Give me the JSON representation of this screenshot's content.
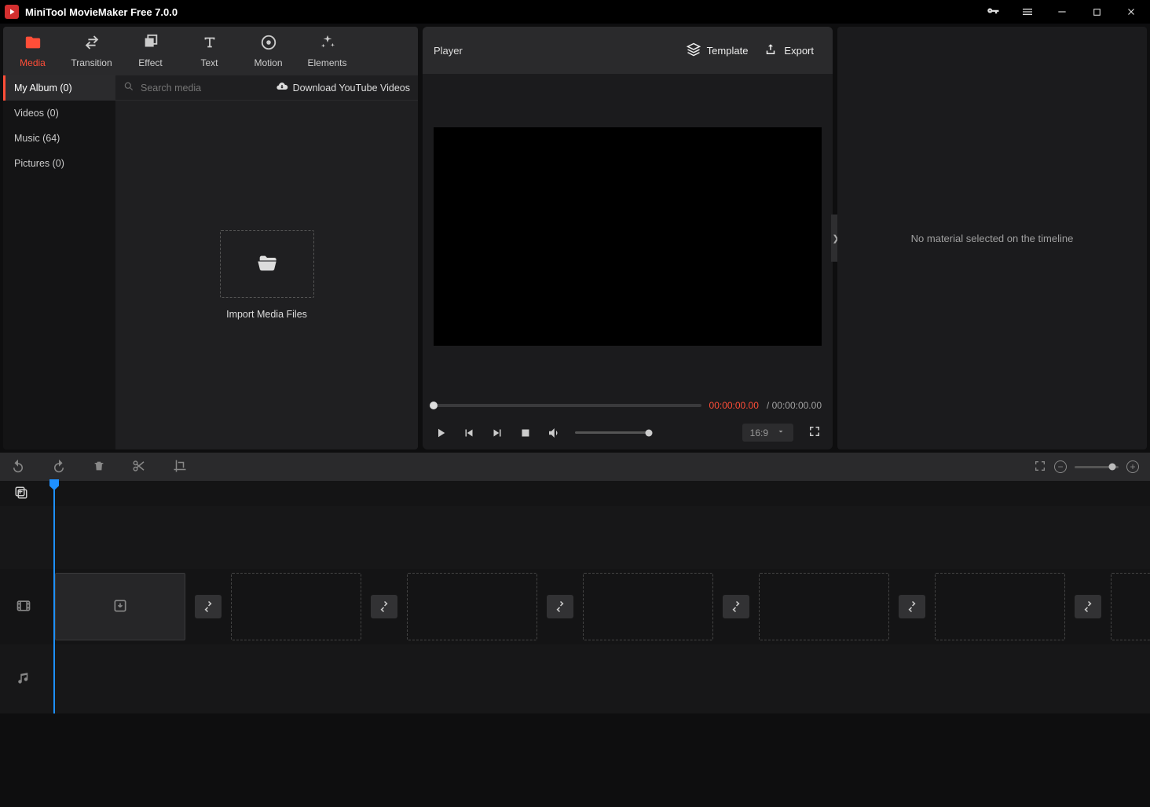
{
  "app": {
    "title": "MiniTool MovieMaker Free 7.0.0"
  },
  "tool_tabs": [
    {
      "label": "Media",
      "icon": "folder"
    },
    {
      "label": "Transition",
      "icon": "swap"
    },
    {
      "label": "Effect",
      "icon": "layers"
    },
    {
      "label": "Text",
      "icon": "text"
    },
    {
      "label": "Motion",
      "icon": "circle-dot"
    },
    {
      "label": "Elements",
      "icon": "sparkle"
    }
  ],
  "albums": [
    {
      "label": "My Album (0)"
    },
    {
      "label": "Videos (0)"
    },
    {
      "label": "Music (64)"
    },
    {
      "label": "Pictures (0)"
    }
  ],
  "media": {
    "search_placeholder": "Search media",
    "download_youtube": "Download YouTube Videos",
    "import_label": "Import Media Files"
  },
  "player": {
    "title": "Player",
    "template_label": "Template",
    "export_label": "Export",
    "aspect": "16:9",
    "time_current": "00:00:00.00",
    "time_sep": "/ ",
    "time_total": "00:00:00.00"
  },
  "inspector": {
    "empty_text": "No material selected on the timeline"
  }
}
